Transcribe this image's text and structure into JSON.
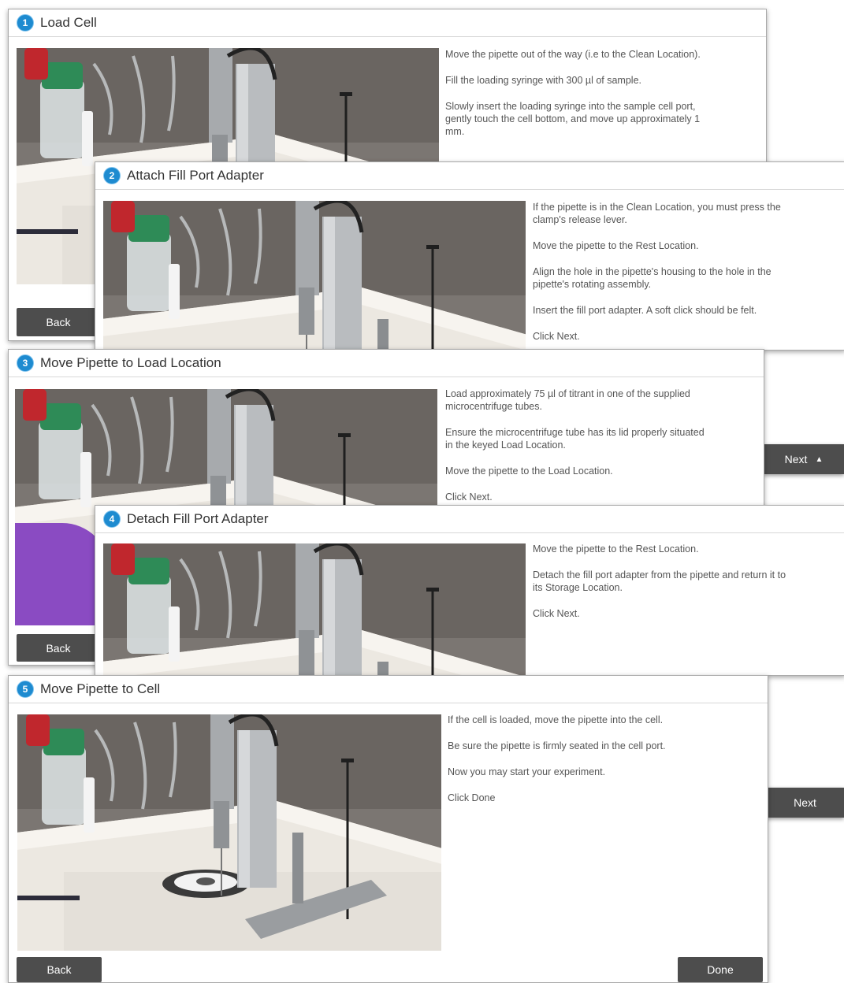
{
  "colors": {
    "accent": "#1e8bd0",
    "button": "#4d4d4d",
    "glove": "#8a4bc2",
    "cap_green": "#2e8b57",
    "cap_red": "#c0272d"
  },
  "panels": [
    {
      "step": "1",
      "title": "Load Cell",
      "instructions": [
        "Move the pipette out of the way (i.e to the Clean Location).",
        "Fill the loading syringe with 300 µl of sample.",
        "Slowly insert the loading syringe into the sample cell port, gently touch the cell bottom, and move up approximately 1 mm."
      ],
      "back_label": "Back"
    },
    {
      "step": "2",
      "title": "Attach Fill Port Adapter",
      "instructions": [
        "If the pipette is in the Clean Location, you must press the clamp's release lever.",
        "Move the pipette to the Rest Location.",
        "Align the hole in the pipette's housing to the hole in the pipette's rotating assembly.",
        "Insert the fill port adapter. A soft click should be felt.",
        "Click Next."
      ]
    },
    {
      "step": "3",
      "title": "Move Pipette to Load Location",
      "instructions": [
        "Load approximately 75 µl of titrant in one of the supplied microcentrifuge tubes.",
        "Ensure the microcentrifuge tube has its lid properly situated in the keyed Load Location.",
        "Move the pipette to the Load Location.",
        "Click Next."
      ],
      "back_label": "Back",
      "next_label": "Next",
      "next_caret": "▲"
    },
    {
      "step": "4",
      "title": "Detach Fill Port Adapter",
      "instructions": [
        "Move the pipette to the Rest Location.",
        "Detach the fill port adapter from the pipette and return it to its Storage Location.",
        "Click Next."
      ]
    },
    {
      "step": "5",
      "title": "Move Pipette to Cell",
      "instructions": [
        "If the cell is loaded, move the pipette into the cell.",
        "Be sure the pipette is firmly seated in the cell port.",
        "Now you may start your experiment.",
        "Click Done"
      ],
      "back_label": "Back",
      "done_label": "Done",
      "next_label": "Next"
    }
  ]
}
